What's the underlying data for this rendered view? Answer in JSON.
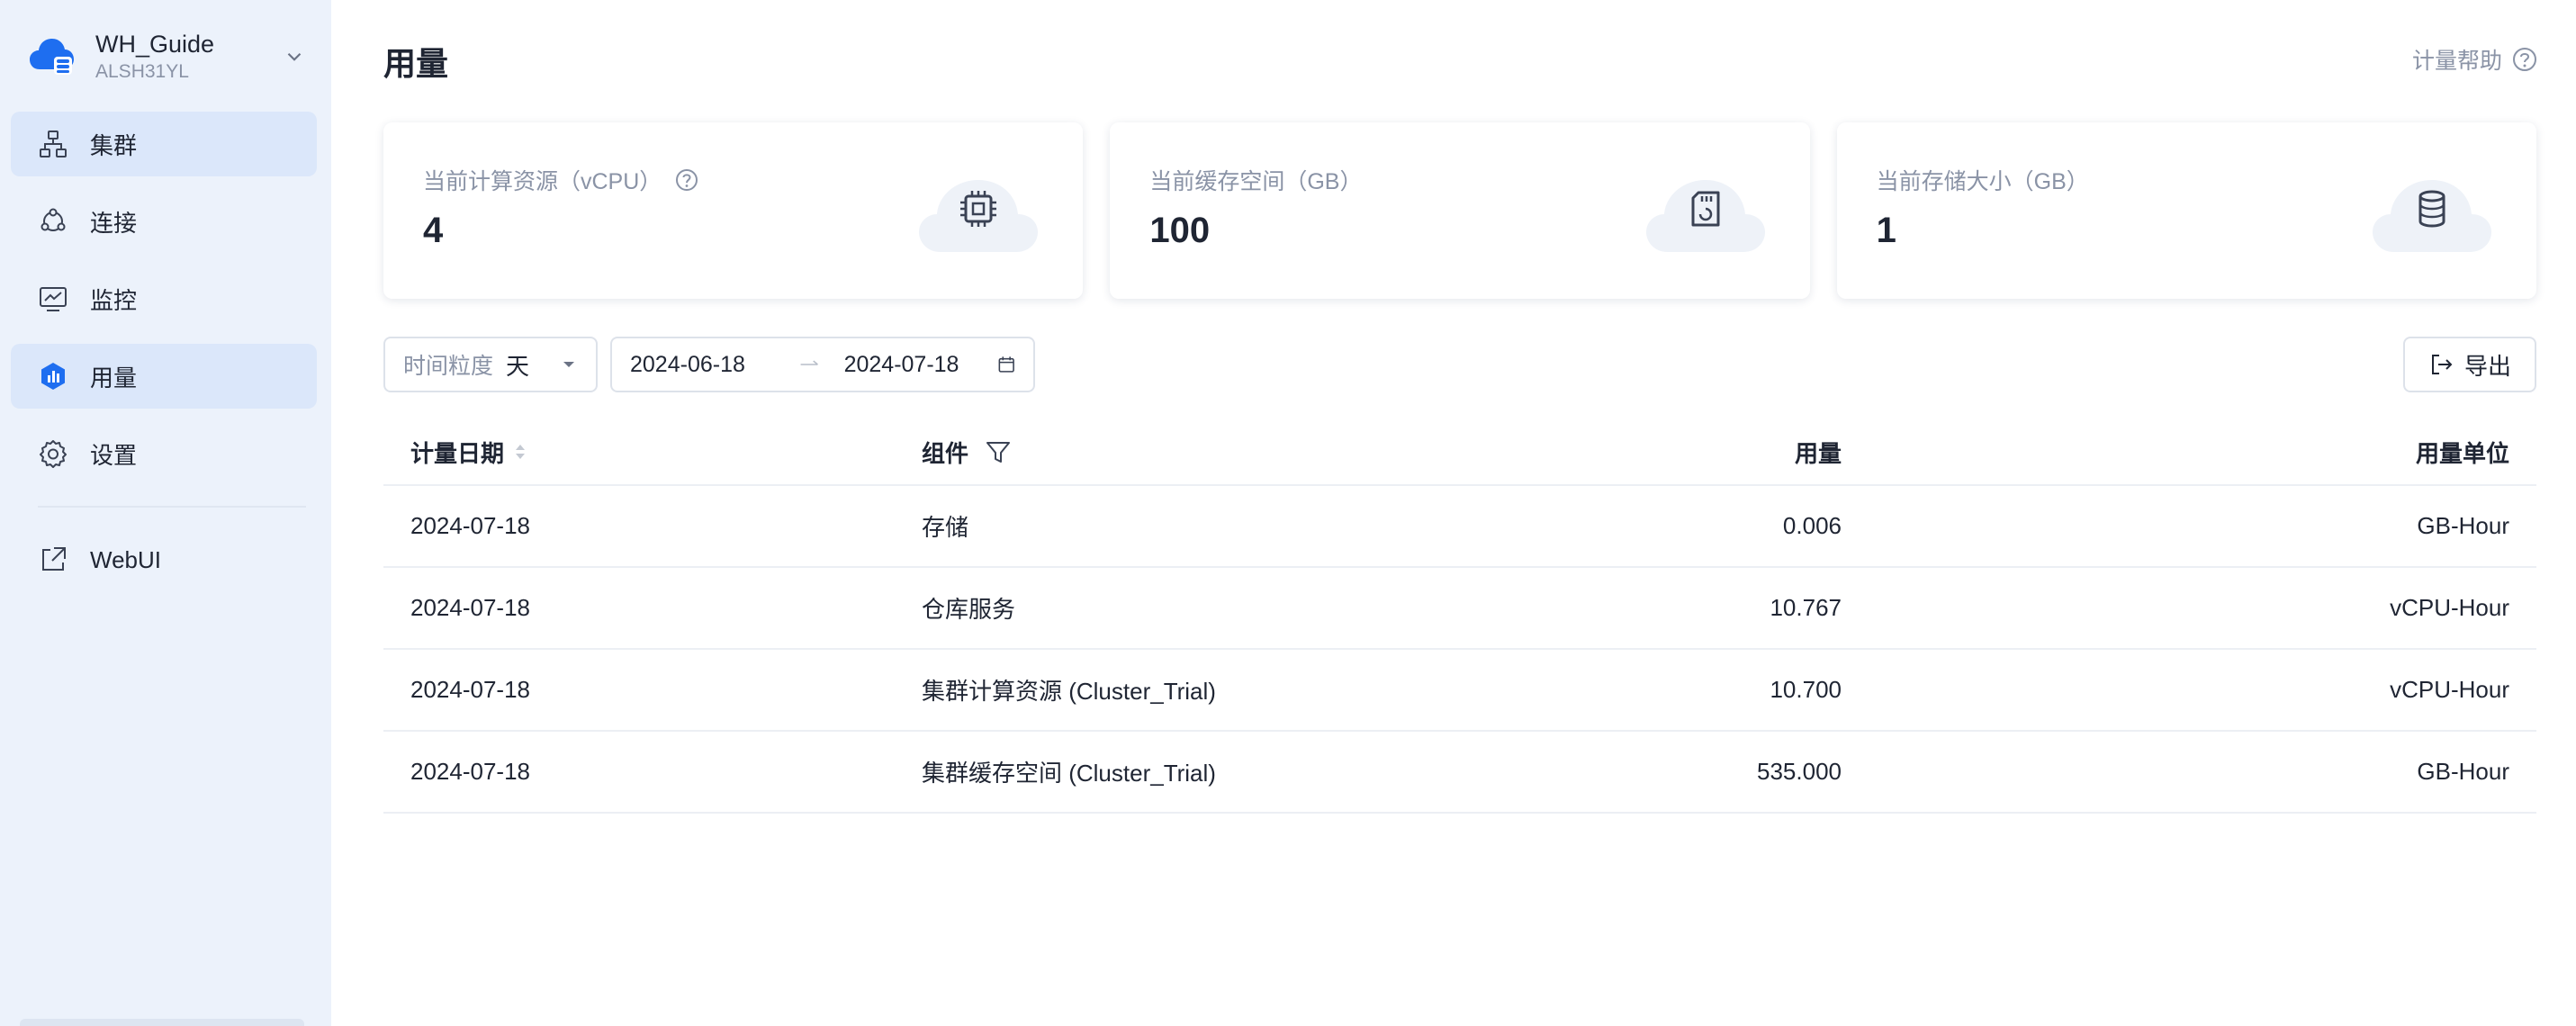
{
  "workspace": {
    "name": "WH_Guide",
    "id": "ALSH31YL"
  },
  "nav": {
    "items": [
      {
        "key": "cluster",
        "label": "集群",
        "icon": "cluster-icon"
      },
      {
        "key": "connect",
        "label": "连接",
        "icon": "connect-icon"
      },
      {
        "key": "monitor",
        "label": "监控",
        "icon": "monitor-icon"
      },
      {
        "key": "usage",
        "label": "用量",
        "icon": "usage-icon"
      },
      {
        "key": "settings",
        "label": "设置",
        "icon": "gear-icon"
      }
    ],
    "webui": {
      "label": "WebUI",
      "icon": "external-link-icon"
    }
  },
  "page": {
    "title": "用量",
    "help_label": "计量帮助"
  },
  "cards": [
    {
      "label": "当前计算资源（vCPU）",
      "value": "4",
      "icon": "cpu-icon"
    },
    {
      "label": "当前缓存空间（GB）",
      "value": "100",
      "icon": "sd-card-icon"
    },
    {
      "label": "当前存储大小（GB）",
      "value": "1",
      "icon": "database-icon"
    }
  ],
  "filters": {
    "granularity_label": "时间粒度",
    "granularity_value": "天",
    "date_start": "2024-06-18",
    "date_end": "2024-07-18",
    "export_label": "导出"
  },
  "table": {
    "columns": [
      "计量日期",
      "组件",
      "用量",
      "用量单位"
    ],
    "rows": [
      [
        "2024-07-18",
        "存储",
        "0.006",
        "GB-Hour"
      ],
      [
        "2024-07-18",
        "仓库服务",
        "10.767",
        "vCPU-Hour"
      ],
      [
        "2024-07-18",
        "集群计算资源 (Cluster_Trial)",
        "10.700",
        "vCPU-Hour"
      ],
      [
        "2024-07-18",
        "集群缓存空间 (Cluster_Trial)",
        "535.000",
        "GB-Hour"
      ]
    ]
  },
  "colors": {
    "sidebar_bg": "#ecf2fb",
    "nav_active_bg": "#dbe7fa",
    "brand_blue": "#1e6ef0",
    "muted_text": "#8a93a6"
  }
}
